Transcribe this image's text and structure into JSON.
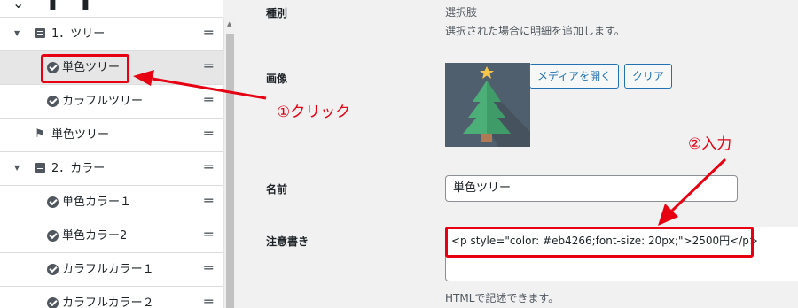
{
  "tree": {
    "items": [
      {
        "label": "1．ツリー",
        "icon": "document-list-icon"
      },
      {
        "label": "単色ツリー",
        "icon": "check-circle-icon"
      },
      {
        "label": "カラフルツリー",
        "icon": "check-circle-icon"
      },
      {
        "label": "単色ツリー",
        "icon": "flag-icon"
      },
      {
        "label": "2．カラー",
        "icon": "document-list-icon"
      },
      {
        "label": "単色カラー１",
        "icon": "check-circle-icon"
      },
      {
        "label": "単色カラー2",
        "icon": "check-circle-icon"
      },
      {
        "label": "カラフルカラー１",
        "icon": "check-circle-icon"
      },
      {
        "label": "カラフルカラー２",
        "icon": "check-circle-icon"
      }
    ],
    "handle_glyph": "═"
  },
  "form": {
    "type": {
      "label": "種別",
      "value": "選択肢",
      "description": "選択された場合に明細を追加します。"
    },
    "image": {
      "label": "画像",
      "open_media_button": "メディアを開く",
      "clear_button": "クリア"
    },
    "name": {
      "label": "名前",
      "value": "単色ツリー"
    },
    "note": {
      "label": "注意書き",
      "value": "<p style=\"color: #eb4266;font-size: 20px;\">2500円</p>",
      "help": "HTMLで記述できます。"
    }
  },
  "annotations": {
    "click": "①クリック",
    "input": "②入力"
  },
  "colors": {
    "annotation_red": "#e60012",
    "button_blue": "#2271b1"
  }
}
